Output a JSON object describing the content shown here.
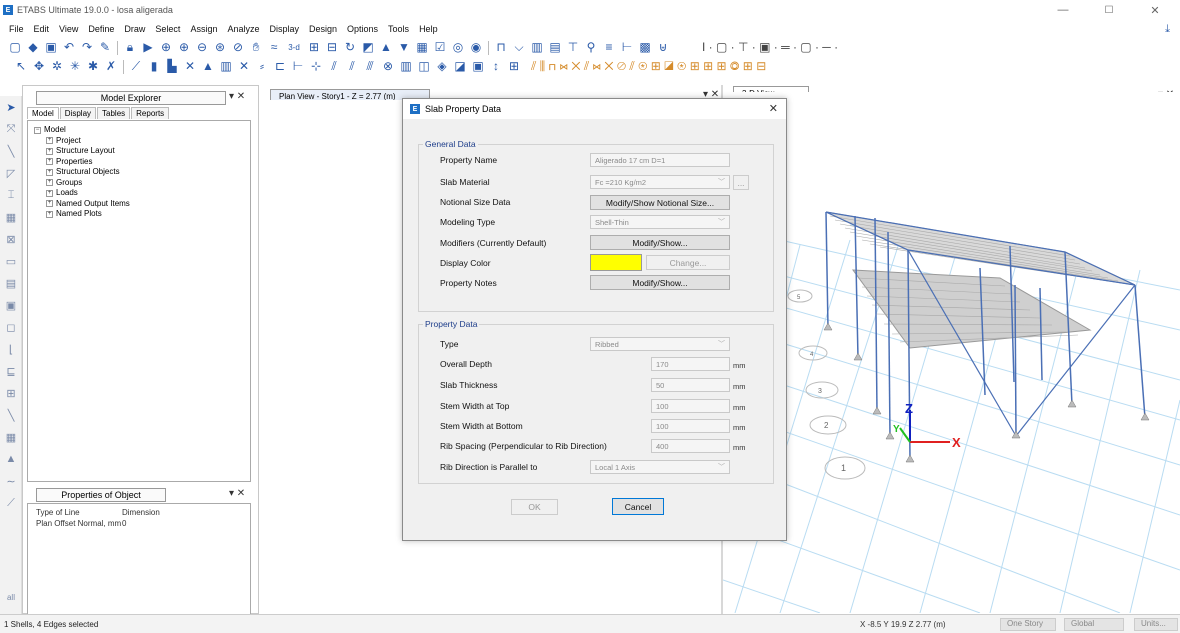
{
  "window": {
    "title": "ETABS Ultimate 19.0.0 - losa aligerada",
    "app_badge": "E",
    "minimize": "—",
    "maximize": "☐",
    "close": "✕"
  },
  "menu": [
    "File",
    "Edit",
    "View",
    "Define",
    "Draw",
    "Select",
    "Assign",
    "Analyze",
    "Display",
    "Design",
    "Options",
    "Tools",
    "Help"
  ],
  "explorer": {
    "header": "Model Explorer",
    "pin": "▾ ✕",
    "tabs": [
      "Model",
      "Display",
      "Tables",
      "Reports"
    ],
    "tree_root": "Model",
    "tree_items": [
      "Project",
      "Structure Layout",
      "Properties",
      "Structural Objects",
      "Groups",
      "Loads",
      "Named Output Items",
      "Named Plots"
    ]
  },
  "properties": {
    "header": "Properties of Object",
    "pin": "▾ ✕",
    "rows": [
      {
        "k": "Type of Line",
        "v": "Dimension"
      },
      {
        "k": "Plan Offset Normal, mm",
        "v": "0"
      }
    ]
  },
  "plan_tab": "Plan View - Story1 - Z = 2.77 (m)",
  "view3d_tab": "3-D View",
  "plan_tab_controls": "▾ ✕",
  "view3d_tab_controls": "▾ ✕",
  "view3d_axes": {
    "z": "Z",
    "x": "X",
    "y": "Y"
  },
  "grid_bubbles": [
    "1",
    "2",
    "3",
    "4",
    "5"
  ],
  "status": {
    "left": "1 Shells, 4 Edges selected",
    "coords": "X -8.5  Y 19.9  Z 2.77 (m)",
    "story": "One Story",
    "system": "Global",
    "units": "Units..."
  },
  "dialog": {
    "title": "Slab Property Data",
    "icon": "E",
    "close": "✕",
    "general": {
      "title": "General Data",
      "property_name_label": "Property Name",
      "property_name": "Aligerado 17 cm D=1",
      "slab_material_label": "Slab Material",
      "slab_material": "Fc =210 Kg/m2",
      "ellipsis": "...",
      "notional_label": "Notional Size Data",
      "notional_btn": "Modify/Show Notional Size...",
      "modeling_label": "Modeling Type",
      "modeling_type": "Shell-Thin",
      "modifiers_label": "Modifiers (Currently Default)",
      "modifiers_btn": "Modify/Show...",
      "display_color_label": "Display Color",
      "display_color": "#ffff00",
      "change_btn": "Change...",
      "notes_label": "Property Notes",
      "notes_btn": "Modify/Show..."
    },
    "propdata": {
      "title": "Property Data",
      "type_label": "Type",
      "type": "Ribbed",
      "rows": [
        {
          "label": "Overall Depth",
          "value": "170",
          "unit": "mm"
        },
        {
          "label": "Slab Thickness",
          "value": "50",
          "unit": "mm"
        },
        {
          "label": "Stem Width at Top",
          "value": "100",
          "unit": "mm"
        },
        {
          "label": "Stem Width at Bottom",
          "value": "100",
          "unit": "mm"
        },
        {
          "label": "Rib Spacing (Perpendicular to Rib Direction)",
          "value": "400",
          "unit": "mm"
        }
      ],
      "rib_dir_label": "Rib Direction is Parallel to",
      "rib_dir": "Local 1 Axis"
    },
    "ok": "OK",
    "cancel": "Cancel"
  },
  "colors": {
    "accent": "#1e6fc4",
    "frame": "#4a6fb5",
    "slab": "#9c9c9c",
    "grid": "#b9dcf2"
  }
}
